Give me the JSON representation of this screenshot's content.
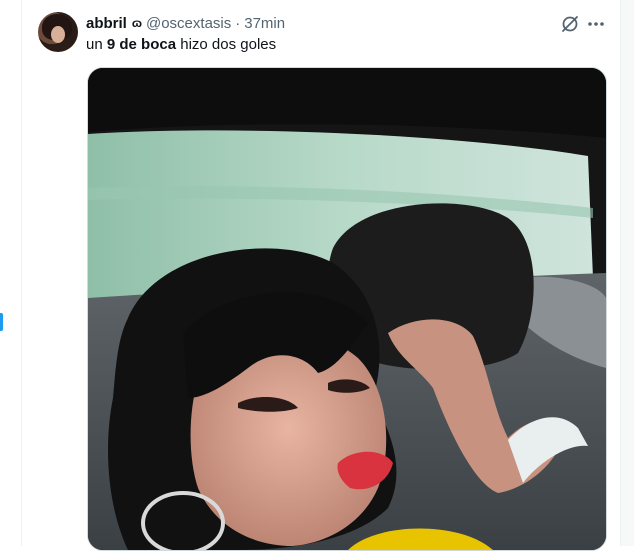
{
  "tweet": {
    "display_name": "abbril",
    "name_glyph": "ɷ",
    "handle": "@oscextasis",
    "separator": "·",
    "time": "37min",
    "text_before": "un ",
    "text_bold": "9 de boca",
    "text_after": " hizo dos goles"
  },
  "icons": {
    "grok": "grok-icon",
    "more": "more-icon"
  },
  "colors": {
    "accent": "#1d9bf0",
    "secondary_text": "#536471",
    "primary_text": "#0f1419"
  }
}
